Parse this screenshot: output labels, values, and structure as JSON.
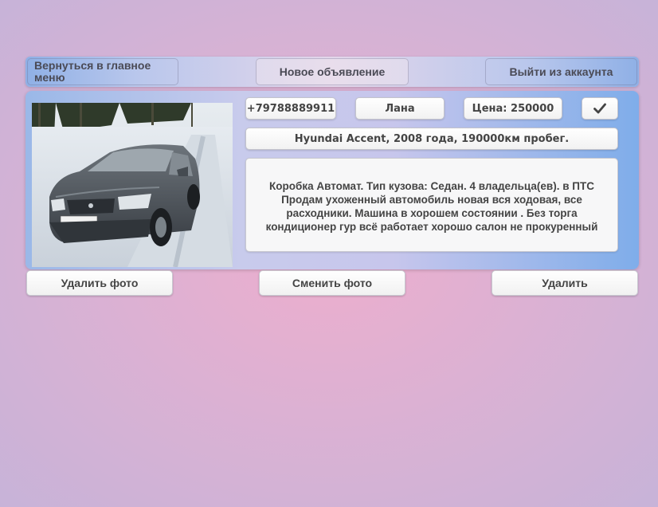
{
  "nav": {
    "back_label": "Вернуться в главное меню",
    "new_ad_label": "Новое объявление",
    "logout_label": "Выйти из аккаунта"
  },
  "listing": {
    "phone": "+79788889911",
    "name": "Лана",
    "price": "Цена: 250000",
    "title": "Hyundai Accent, 2008 года, 190000км пробег.",
    "description": "Коробка Автомат. Тип кузова: Седан. 4 владельца(ев). в ПТС Продам ухоженный автомобиль новая вся ходовая, все расходники. Машина в хорошем состоянии . Без торга кондиционер гур всё работает хорошо салон не прокуренный",
    "photo_alt": "photo"
  },
  "actions": {
    "delete_photo_label": "Удалить фото",
    "change_photo_label": "Сменить фото",
    "delete_label": "Удалить"
  },
  "icons": {
    "confirm": "check-icon"
  },
  "colors": {
    "accent": "#7fadea"
  }
}
